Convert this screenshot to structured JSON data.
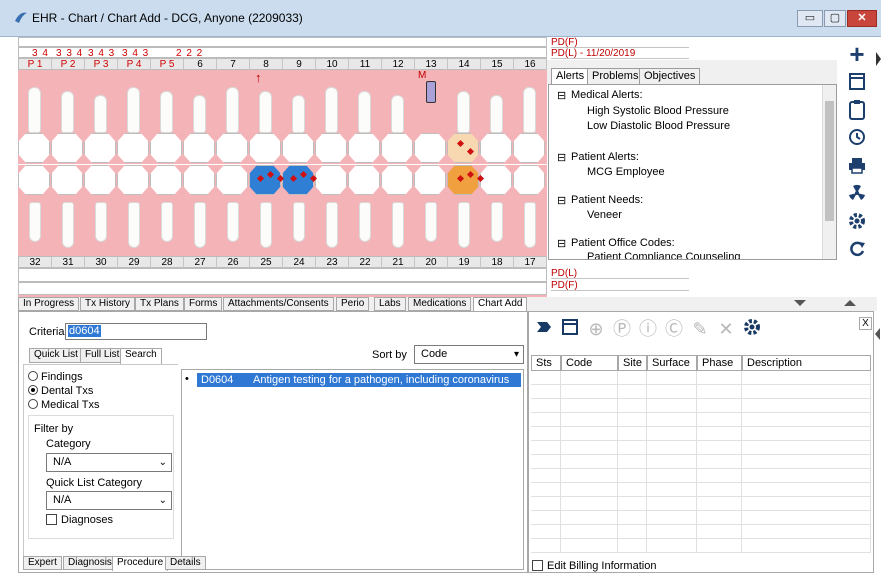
{
  "window": {
    "title": "EHR - Chart / Chart Add - DCG, Anyone (2209033)",
    "minimize": "▭",
    "maximize": "▢",
    "close": "✕"
  },
  "chart": {
    "upper_numbers": [
      "P 1",
      "P 2",
      "P 3",
      "P 4",
      "P 5",
      "6",
      "7",
      "8",
      "9",
      "10",
      "11",
      "12",
      "13",
      "14",
      "15",
      "16"
    ],
    "lower_numbers": [
      "32",
      "31",
      "30",
      "29",
      "28",
      "27",
      "26",
      "25",
      "24",
      "23",
      "22",
      "21",
      "20",
      "19",
      "18",
      "17"
    ],
    "perio_values": [
      "3 4",
      "3 3 4",
      "3 4 3",
      "3 4 3",
      "2 2 2"
    ],
    "pd_labels": [
      "PD(F)",
      "PD(L) - 11/20/2019",
      "PD(L)",
      "PD(F)"
    ],
    "marker_m": "M",
    "marker_arrow": "↑"
  },
  "alerts": {
    "tabs": [
      "Alerts",
      "Problems",
      "Objectives"
    ],
    "sections": [
      {
        "header": "Medical Alerts:",
        "items": [
          "High Systolic Blood Pressure",
          "Low Diastolic Blood Pressure"
        ]
      },
      {
        "header": "Patient Alerts:",
        "items": [
          "MCG Employee"
        ]
      },
      {
        "header": "Patient Needs:",
        "items": [
          "Veneer"
        ]
      },
      {
        "header": "Patient Office Codes:",
        "items": [
          "Patient Compliance Counseling"
        ]
      }
    ],
    "collapse_glyph": "⊟"
  },
  "sidebar_icons": [
    "plus-icon",
    "calendar-icon",
    "clipboard-icon",
    "history-icon",
    "print-icon",
    "radiation-icon",
    "gear-icon",
    "refresh-icon"
  ],
  "bottom_tabs": [
    "In Progress",
    "Tx History",
    "Tx Plans",
    "Forms",
    "Attachments/Consents",
    "Perio",
    "Labs",
    "Medications",
    "Chart Add"
  ],
  "active_tab": "Chart Add",
  "chart_add": {
    "criteria_label": "Criteria",
    "criteria_value": "d0604",
    "list_tabs": [
      "Quick List",
      "Full List",
      "Search"
    ],
    "sort_label": "Sort by",
    "sort_value": "Code",
    "radios": [
      {
        "label": "Findings",
        "checked": false
      },
      {
        "label": "Dental Txs",
        "checked": true
      },
      {
        "label": "Medical Txs",
        "checked": false
      }
    ],
    "filter_by": "Filter by",
    "category_label": "Category",
    "category_value": "N/A",
    "quick_list_category_label": "Quick List Category",
    "quick_list_category_value": "N/A",
    "diagnoses_label": "Diagnoses",
    "result_bullet": "•",
    "result_code": "D0604",
    "result_desc": "Antigen testing for a pathogen, including coronavirus",
    "bottom_tabs": [
      "Expert",
      "Diagnosis",
      "Procedure",
      "Details"
    ]
  },
  "right_panel": {
    "close": "X",
    "columns": [
      "Sts",
      "Code",
      "Site",
      "Surface",
      "Phase",
      "Description"
    ],
    "edit_billing": "Edit Billing Information"
  }
}
